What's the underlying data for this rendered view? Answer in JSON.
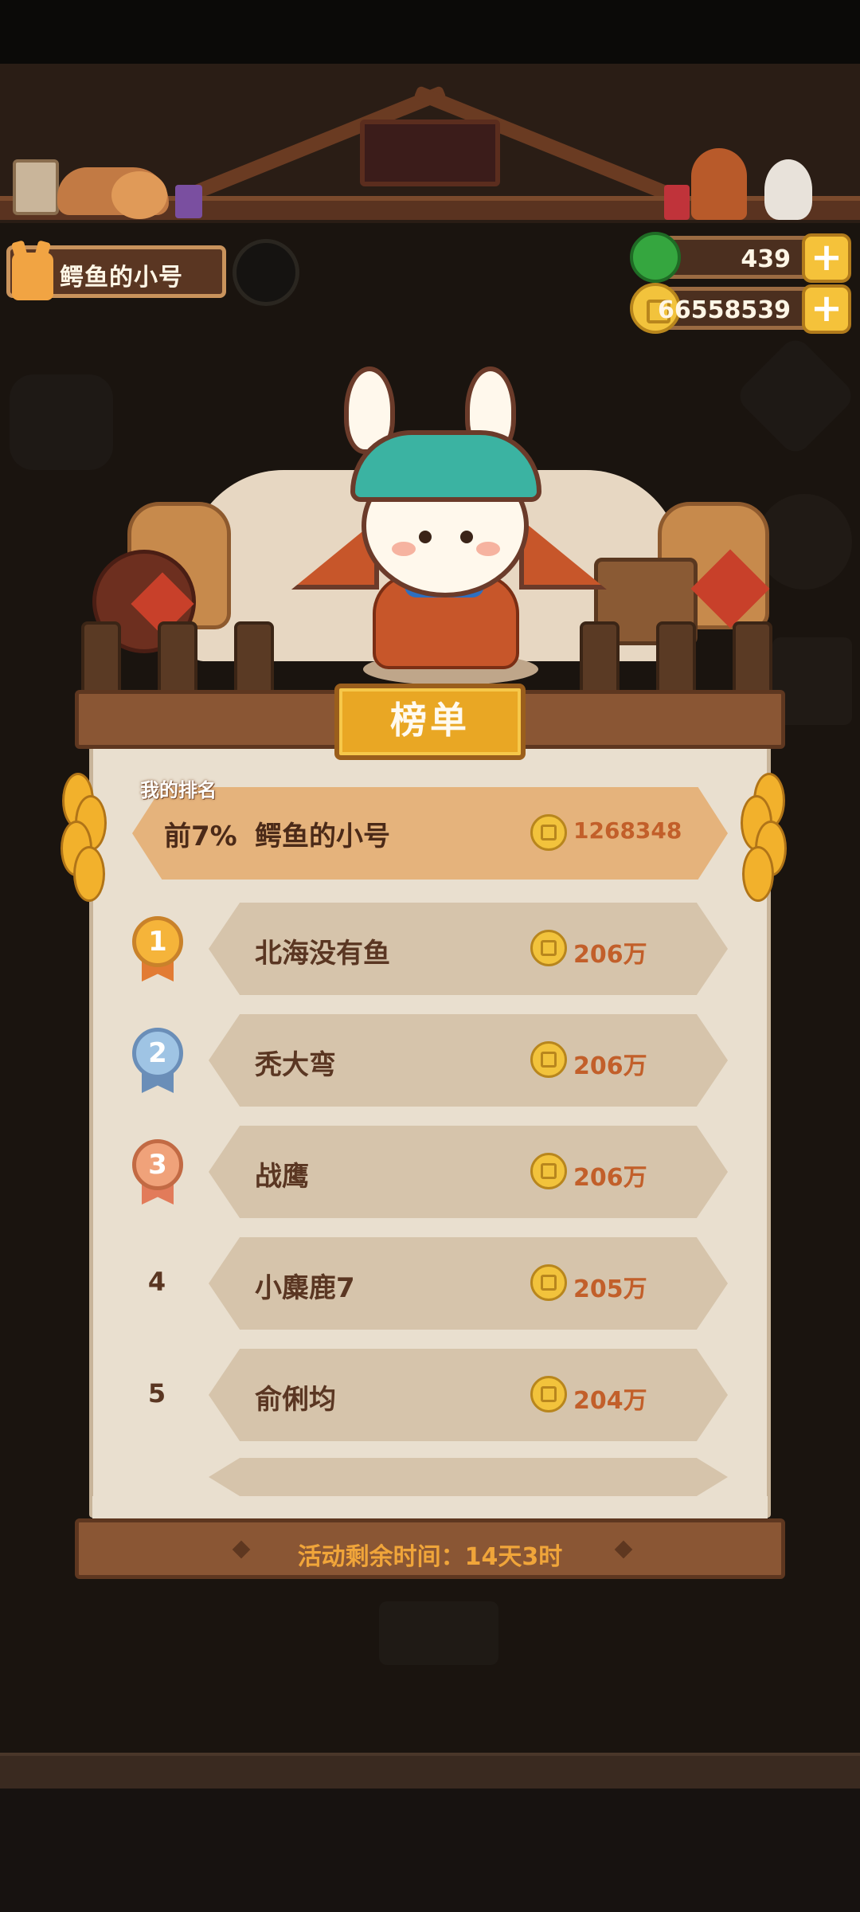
{
  "player": {
    "name": "鳄鱼的小号"
  },
  "resources": {
    "energy": "439",
    "gold": "66558539"
  },
  "leaderboard": {
    "title": "榜单",
    "my_rank_label": "我的排名",
    "my_entry": {
      "percentile": "前7%",
      "name": "鳄鱼的小号",
      "score": "1268348"
    },
    "entries": [
      {
        "rank": "1",
        "name": "北海没有鱼",
        "score": "206万"
      },
      {
        "rank": "2",
        "name": "秃大弯",
        "score": "206万"
      },
      {
        "rank": "3",
        "name": "战鹰",
        "score": "206万"
      },
      {
        "rank": "4",
        "name": "小麋鹿7",
        "score": "205万"
      },
      {
        "rank": "5",
        "name": "俞俐均",
        "score": "204万"
      }
    ],
    "footer": "活动剩余时间：14天3时"
  },
  "colors": {
    "accent_gold": "#f2c33c",
    "score_text": "#c25f2a",
    "panel_bg": "#e9dfcf",
    "my_row_bg": "#e5b37c",
    "wood": "#8a5634"
  },
  "icons": {
    "energy": "green-coin-icon",
    "gold": "gold-coin-icon",
    "plus": "plus-icon",
    "medal_1": "gold-medal-icon",
    "medal_2": "silver-medal-icon",
    "medal_3": "bronze-medal-icon"
  }
}
